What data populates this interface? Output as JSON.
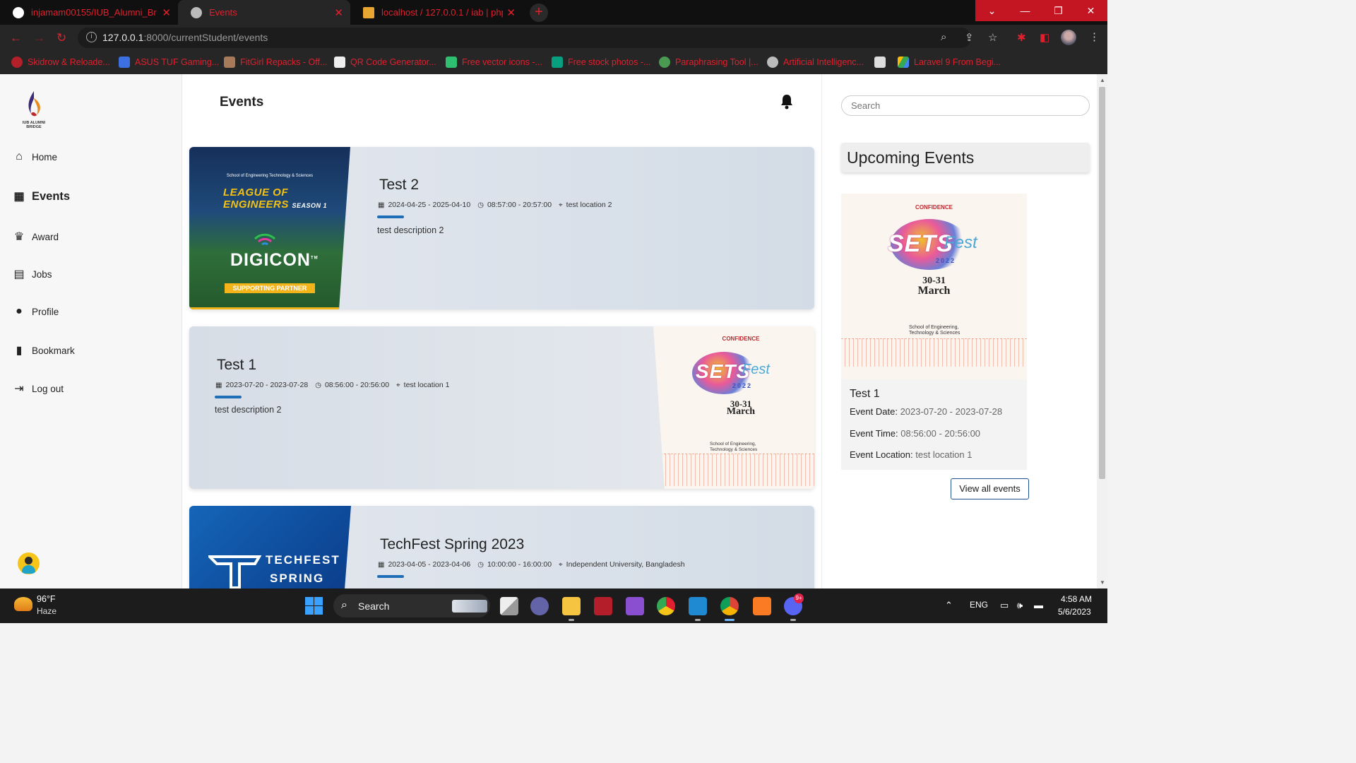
{
  "browser": {
    "tabs": [
      {
        "title": "injamam00155/IUB_Alumni_Bridge"
      },
      {
        "title": "Events"
      },
      {
        "title": "localhost / 127.0.0.1 / iab | phpMyAdmin"
      }
    ],
    "url_host": "127.0.0.1",
    "url_path": ":8000/currentStudent/events",
    "bookmarks": [
      "Skidrow & Reloade...",
      "ASUS TUF Gaming...",
      "FitGirl Repacks - Off...",
      "QR Code Generator...",
      "Free vector icons -...",
      "Free stock photos -...",
      "Paraphrasing Tool |...",
      "Artificial Intelligenc...",
      "",
      "Laravel 9 From Begi..."
    ]
  },
  "sidebar": {
    "logo_caption": "IUB ALUMNI BRIDGE",
    "items": [
      {
        "label": "Home",
        "icon": "home-icon"
      },
      {
        "label": "Events",
        "icon": "calendar-icon"
      },
      {
        "label": "Award",
        "icon": "trophy-icon"
      },
      {
        "label": "Jobs",
        "icon": "briefcase-icon"
      },
      {
        "label": "Profile",
        "icon": "user-icon"
      },
      {
        "label": "Bookmark",
        "icon": "bookmark-icon"
      },
      {
        "label": "Log out",
        "icon": "logout-icon"
      }
    ]
  },
  "main": {
    "title": "Events",
    "events": [
      {
        "name": "Test 2",
        "dates": "2024-04-25 - 2025-04-10",
        "time": "08:57:00 - 20:57:00",
        "location": "test location 2",
        "description": "test description 2",
        "image": {
          "school": "School of Engineering Technology & Sciences",
          "league": "LEAGUE OF ENGINEERS",
          "season": "SEASON 1",
          "brand": "DIGICON",
          "tm": "TM",
          "partner": "SUPPORTING PARTNER"
        }
      },
      {
        "name": "Test 1",
        "dates": "2023-07-20 - 2023-07-28",
        "time": "08:56:00 - 20:56:00",
        "location": "test location 1",
        "description": "test description 2"
      },
      {
        "name": "TechFest Spring 2023",
        "dates": "2023-04-05 - 2023-04-06",
        "time": "10:00:00 - 16:00:00",
        "location": "Independent University, Bangladesh",
        "image": {
          "line1": "TECHFEST",
          "line2": "SPRING"
        }
      }
    ],
    "sets_poster": {
      "sponsor": "CONFIDENCE",
      "sets": "SETS",
      "fest": "Fest",
      "year": "2022",
      "date_line1": "30-31",
      "date_line2": "March",
      "school_line1": "School of Engineering,",
      "school_line2": "Technology & Sciences"
    }
  },
  "right_panel": {
    "search_placeholder": "Search",
    "upcoming_title": "Upcoming Events",
    "event": {
      "name": "Test 1",
      "date_label": "Event Date:",
      "date_value": "2023-07-20 - 2023-07-28",
      "time_label": "Event Time:",
      "time_value": "08:56:00 - 20:56:00",
      "location_label": "Event Location:",
      "location_value": "test location 1"
    },
    "view_all": "View all events"
  },
  "taskbar": {
    "temperature": "96°F",
    "weather": "Haze",
    "search": "Search",
    "language": "ENG",
    "time": "4:58 AM",
    "date": "5/6/2023",
    "discord_badge": "9+"
  }
}
